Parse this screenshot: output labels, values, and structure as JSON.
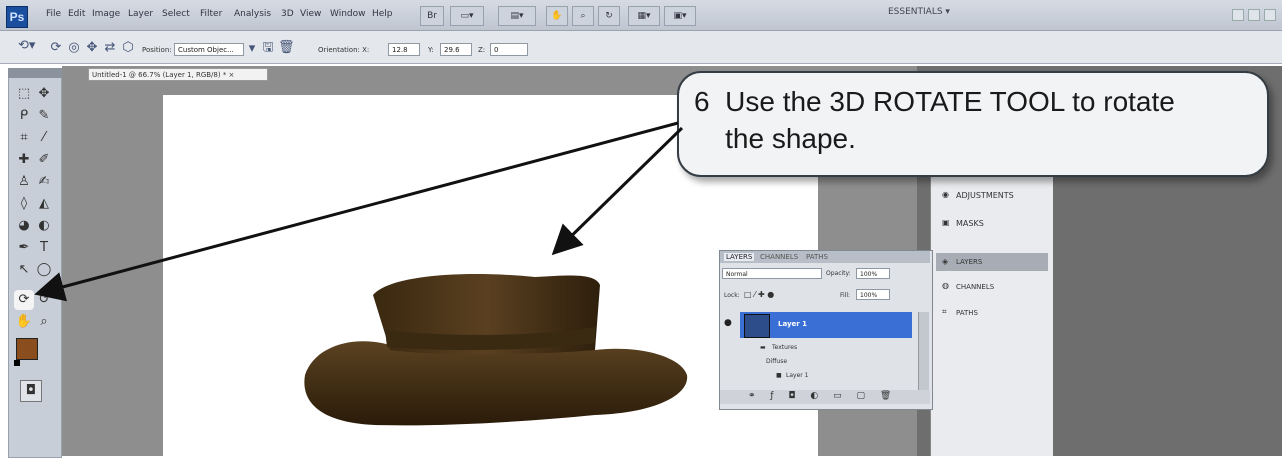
{
  "app": {
    "logo": "Ps",
    "menu_items": [
      "File",
      "Edit",
      "Image",
      "Layer",
      "Select",
      "Filter",
      "Analysis",
      "3D",
      "View",
      "Window",
      "Help"
    ],
    "workspace_label": "ESSENTIALS ▾"
  },
  "options_bar": {
    "position_label": "Position:",
    "position_value": "Custom Objec...",
    "orientation_label": "Orientation: X:",
    "x_value": "12.8",
    "y_label": "Y:",
    "y_value": "29.6",
    "z_label": "Z:",
    "z_value": "0"
  },
  "document": {
    "tab_title": "Untitled-1 @ 66.7% (Layer 1, RGB/8) * ×"
  },
  "right_panel": {
    "adjustments_label": "ADJUSTMENTS",
    "masks_label": "MASKS",
    "layers_label": "LAYERS",
    "channels_label": "CHANNELS",
    "paths_label": "PATHS"
  },
  "layers_panel": {
    "tab_layers": "LAYERS",
    "tab_channels": "CHANNELS",
    "tab_paths": "PATHS",
    "blend_mode": "Normal",
    "opacity_label": "Opacity:",
    "opacity_value": "100%",
    "lock_label": "Lock:",
    "fill_label": "Fill:",
    "fill_value": "100%",
    "layer_name": "Layer 1",
    "sub_textures": "Textures",
    "sub_diffuse": "Diffuse",
    "sub_layer": "Layer 1"
  },
  "callout": {
    "line1": "6  Use the 3D ROTATE TOOL to rotate",
    "line2": "    the shape."
  },
  "colors": {
    "hat_dark": "#2e1f0c",
    "hat_mid": "#5a4020",
    "foreground_swatch": "#8a4e1e",
    "accent": "#3a6fd6"
  }
}
